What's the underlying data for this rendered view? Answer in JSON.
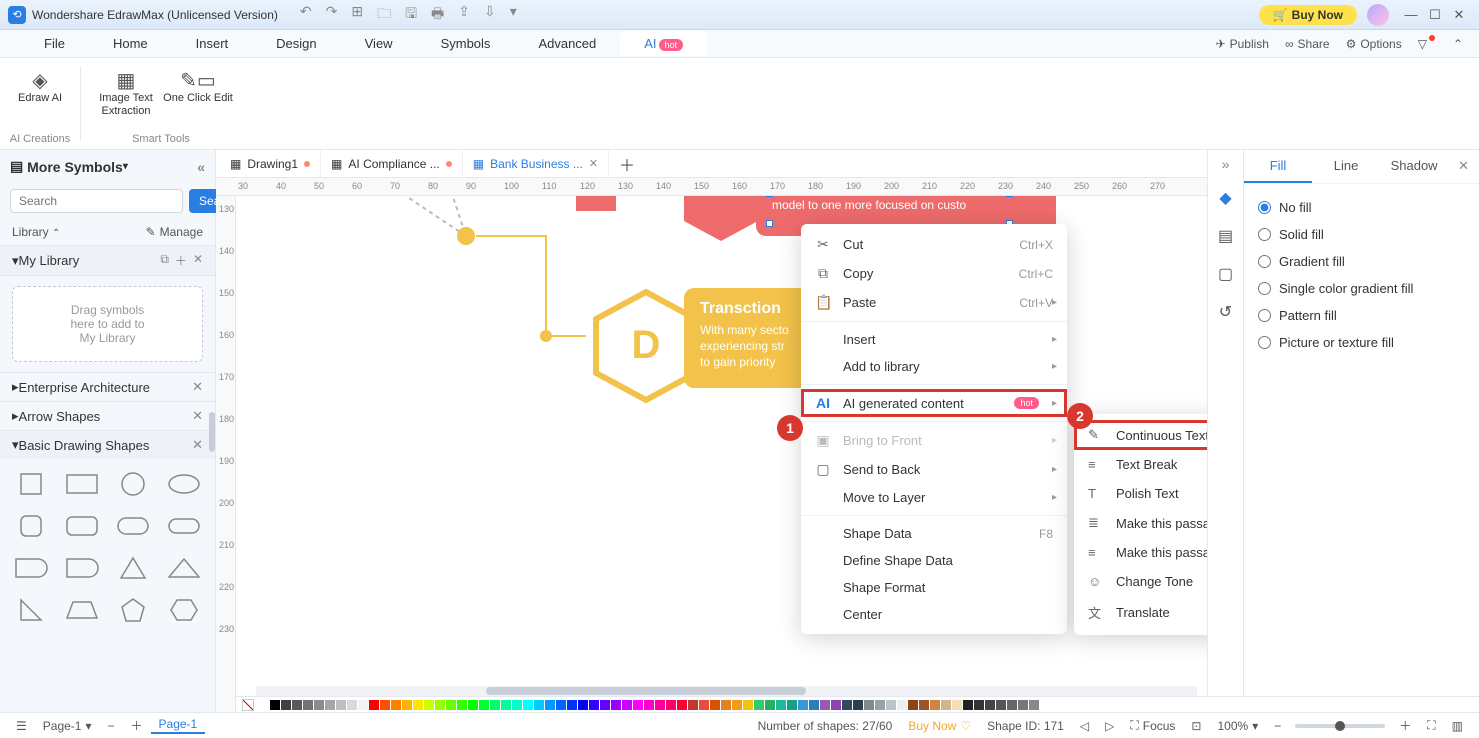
{
  "title": "Wondershare EdrawMax (Unlicensed Version)",
  "buy_now": "Buy Now",
  "menu": {
    "items": [
      "File",
      "Home",
      "Insert",
      "Design",
      "View",
      "Symbols",
      "Advanced",
      "AI"
    ],
    "active": "AI",
    "hot": "hot",
    "right": {
      "publish": "Publish",
      "share": "Share",
      "options": "Options"
    }
  },
  "ribbon": {
    "group1": {
      "label": "AI Creations",
      "items": [
        {
          "label": "Edraw AI"
        }
      ]
    },
    "group2": {
      "label": "Smart Tools",
      "items": [
        {
          "label": "Image Text Extraction"
        },
        {
          "label": "One Click Edit"
        }
      ]
    }
  },
  "left": {
    "header": "More Symbols",
    "search_ph": "Search",
    "search_btn": "Search",
    "library": "Library",
    "manage": "Manage",
    "mylib": "My Library",
    "dropzone": "Drag symbols\nhere to add to\nMy Library",
    "sections": [
      "Enterprise Architecture",
      "Arrow Shapes",
      "Basic Drawing Shapes"
    ]
  },
  "tabs": [
    {
      "label": "Drawing1",
      "mod": true,
      "active": false
    },
    {
      "label": "AI Compliance ...",
      "mod": true,
      "active": false
    },
    {
      "label": "Bank Business ...",
      "mod": false,
      "active": true,
      "close": true
    }
  ],
  "ruler_h": [
    "30",
    "40",
    "50",
    "60",
    "70",
    "80",
    "90",
    "100",
    "110",
    "120",
    "130",
    "140",
    "150",
    "160",
    "170",
    "180",
    "190",
    "200",
    "210",
    "220",
    "230",
    "240",
    "250",
    "260",
    "270"
  ],
  "ruler_v": [
    "130",
    "140",
    "150",
    "160",
    "170",
    "180",
    "190",
    "200",
    "210",
    "220",
    "230"
  ],
  "canvas": {
    "red_text": "model to one more focused on custo",
    "yel_title": "Transction",
    "yel_text": "With many secto\nexperiencing str\nto gain priority",
    "hexD": "D"
  },
  "ctx": {
    "cut": "Cut",
    "cut_sc": "Ctrl+X",
    "copy": "Copy",
    "copy_sc": "Ctrl+C",
    "paste": "Paste",
    "paste_sc": "Ctrl+V",
    "insert": "Insert",
    "addlib": "Add to library",
    "ai": "AI generated content",
    "hot": "hot",
    "btf": "Bring to Front",
    "stb": "Send to Back",
    "mtl": "Move to Layer",
    "sd": "Shape Data",
    "sd_sc": "F8",
    "dsd": "Define Shape Data",
    "sf": "Shape Format",
    "center": "Center"
  },
  "sub": {
    "ct": "Continuous Text",
    "tb": "Text Break",
    "pt": "Polish Text",
    "long": "Make this passage longer",
    "short": "Make this passage shorter",
    "tone": "Change Tone",
    "tr": "Translate"
  },
  "right_panel": {
    "tabs": [
      "Fill",
      "Line",
      "Shadow"
    ],
    "active": "Fill",
    "opts": [
      "No fill",
      "Solid fill",
      "Gradient fill",
      "Single color gradient fill",
      "Pattern fill",
      "Picture or texture fill"
    ],
    "selected": "No fill"
  },
  "status": {
    "page": "Page-1",
    "page_label": "Page-1",
    "shapes": "Number of shapes: 27/60",
    "buy": "Buy Now",
    "shapeid": "Shape ID: 171",
    "focus": "Focus",
    "zoom": "100%"
  },
  "badges": {
    "one": "1",
    "two": "2"
  },
  "colors": [
    "#ffffff",
    "#000000",
    "#404040",
    "#595959",
    "#737373",
    "#8c8c8c",
    "#a6a6a6",
    "#bfbfbf",
    "#d9d9d9",
    "#f2f2f2",
    "#ff0000",
    "#ff4d00",
    "#ff8000",
    "#ffb300",
    "#ffe600",
    "#ccff00",
    "#99ff00",
    "#66ff00",
    "#33ff00",
    "#00ff00",
    "#00ff33",
    "#00ff66",
    "#00ff99",
    "#00ffcc",
    "#00ffff",
    "#00ccff",
    "#0099ff",
    "#0066ff",
    "#0033ff",
    "#0000ff",
    "#3300ff",
    "#6600ff",
    "#9900ff",
    "#cc00ff",
    "#ff00ff",
    "#ff00cc",
    "#ff0099",
    "#ff0066",
    "#ff0033",
    "#c0392b",
    "#e74c3c",
    "#d35400",
    "#e67e22",
    "#f39c12",
    "#f1c40f",
    "#2ecc71",
    "#27ae60",
    "#1abc9c",
    "#16a085",
    "#3498db",
    "#2980b9",
    "#9b59b6",
    "#8e44ad",
    "#34495e",
    "#2c3e50",
    "#7f8c8d",
    "#95a5a6",
    "#bdc3c7",
    "#ecf0f1",
    "#8b4513",
    "#a0522d",
    "#cd853f",
    "#d2b48c",
    "#f5deb3",
    "#222",
    "#333",
    "#444",
    "#555",
    "#666",
    "#777",
    "#888"
  ]
}
